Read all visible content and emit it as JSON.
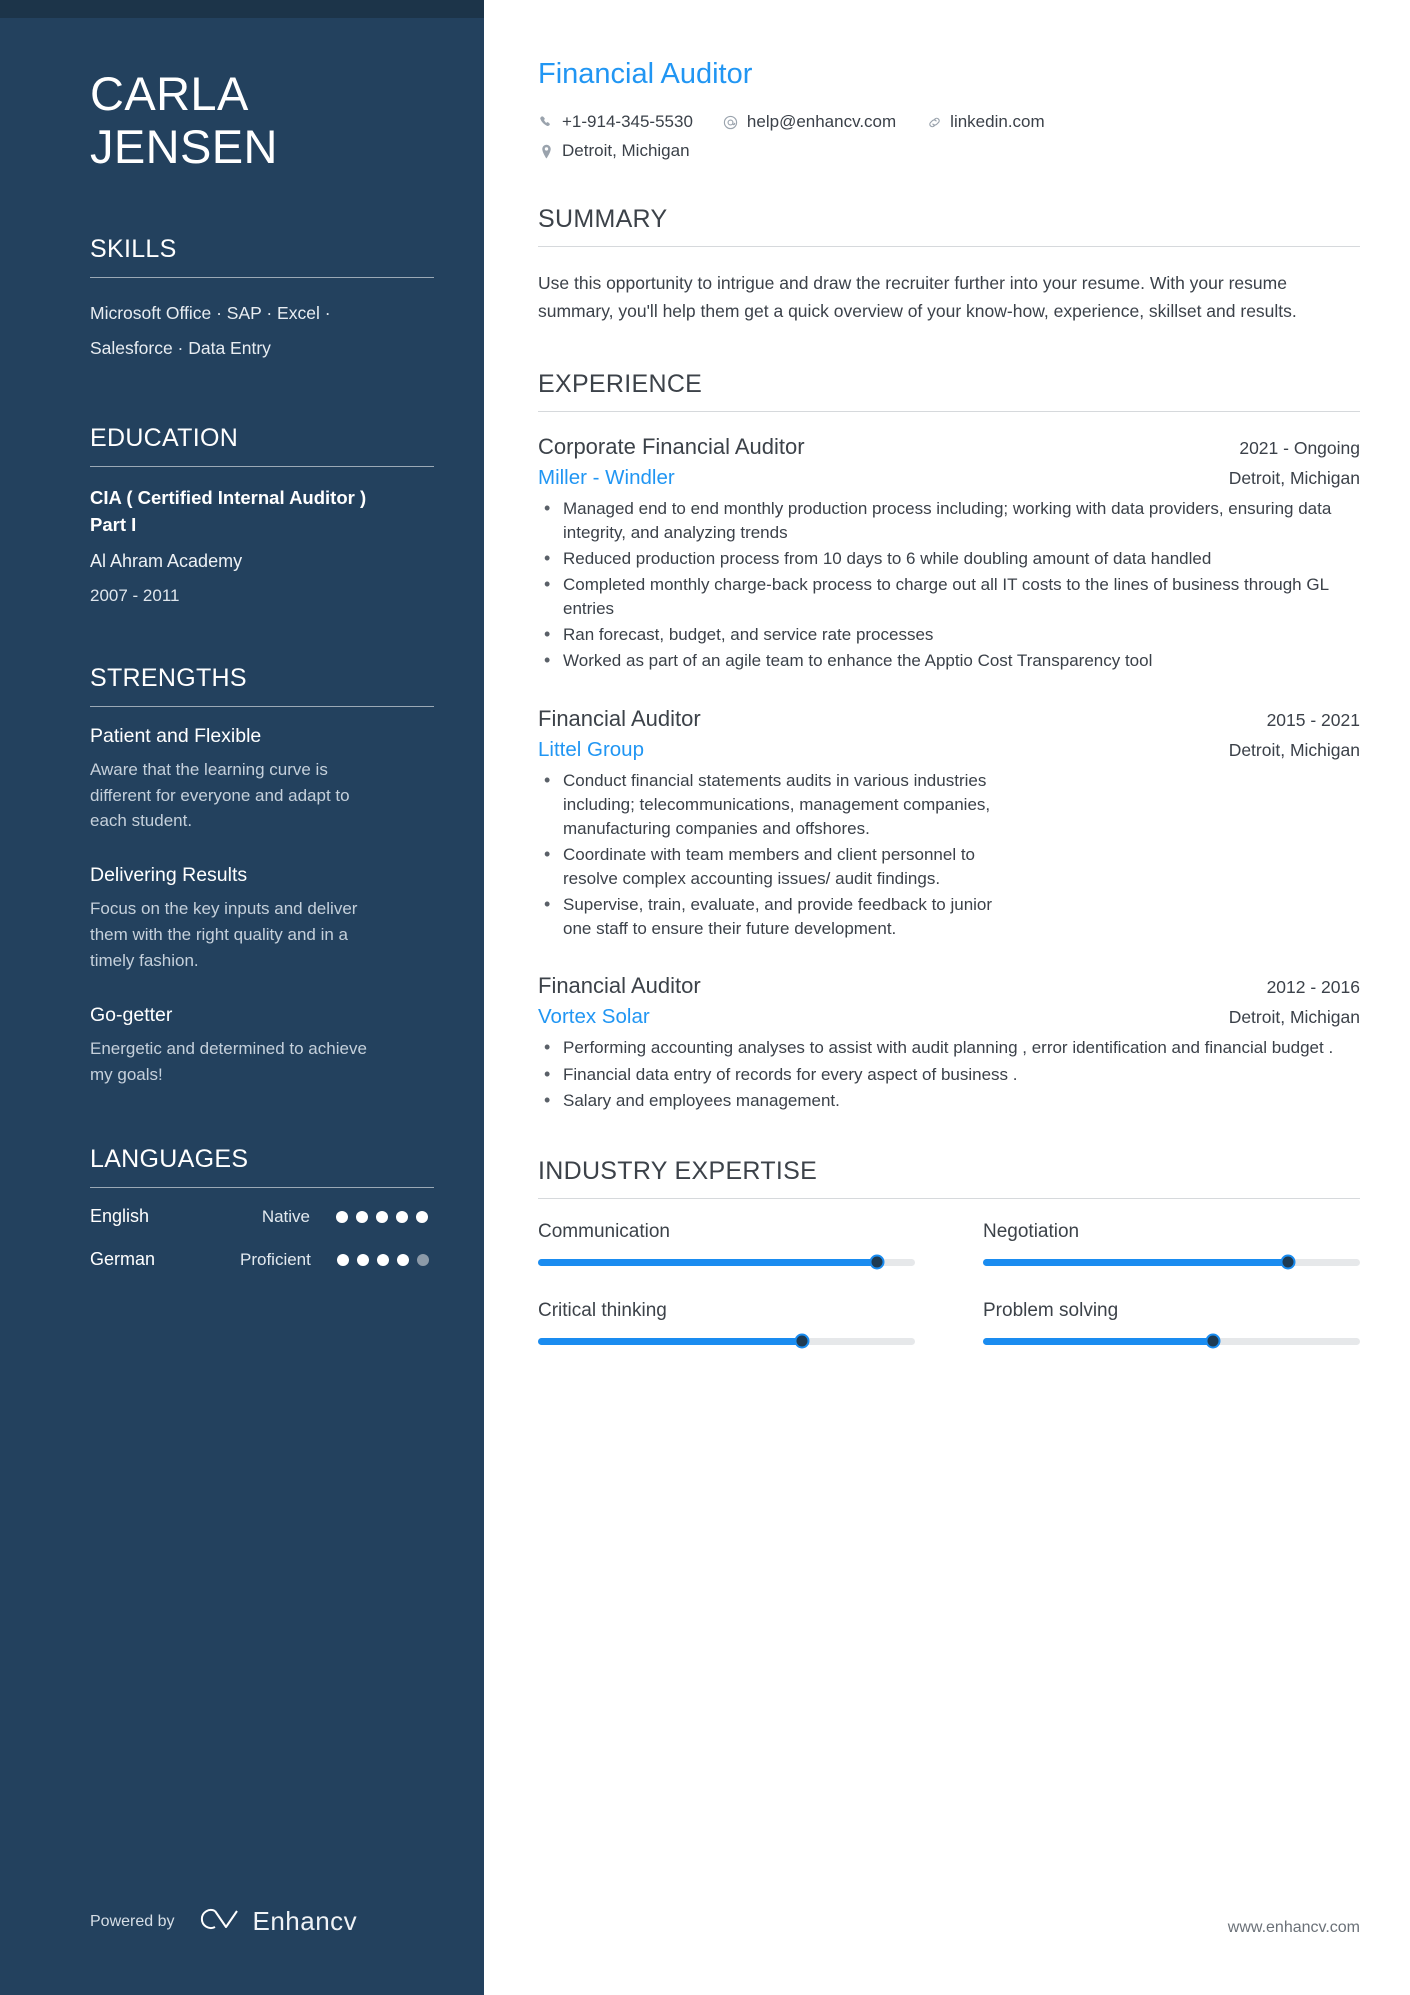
{
  "sidebar": {
    "name_line1": "CARLA",
    "name_line2": "JENSEN",
    "skills": {
      "heading": "SKILLS",
      "line1": "Microsoft Office · SAP · Excel ·",
      "line2": "Salesforce · Data Entry"
    },
    "education": {
      "heading": "EDUCATION",
      "degree": "CIA ( Certified Internal Auditor ) Part I",
      "school": "Al Ahram Academy",
      "dates": "2007 - 2011"
    },
    "strengths": {
      "heading": "STRENGTHS",
      "items": [
        {
          "title": "Patient and Flexible",
          "desc": "Aware that the learning curve is different for everyone and adapt to each student."
        },
        {
          "title": "Delivering Results",
          "desc": "Focus on the key inputs and deliver them with the right quality and in a timely fashion."
        },
        {
          "title": "Go-getter",
          "desc": "Energetic and determined to achieve my goals!"
        }
      ]
    },
    "languages": {
      "heading": "LANGUAGES",
      "items": [
        {
          "name": "English",
          "level": "Native",
          "filled": 5,
          "total": 5
        },
        {
          "name": "German",
          "level": "Proficient",
          "filled": 4,
          "total": 5
        }
      ]
    },
    "footer": {
      "powered_by": "Powered by",
      "brand": "Enhancv"
    }
  },
  "main": {
    "job_title": "Financial Auditor",
    "contact": {
      "phone": "+1-914-345-5530",
      "email": "help@enhancv.com",
      "linkedin": "linkedin.com",
      "location": "Detroit, Michigan"
    },
    "summary": {
      "heading": "SUMMARY",
      "text": "Use this opportunity to intrigue and draw the recruiter further into your resume. With your resume summary, you'll help them get a quick overview of your know-how, experience, skillset and results."
    },
    "experience": {
      "heading": "EXPERIENCE",
      "jobs": [
        {
          "role": "Corporate Financial Auditor",
          "dates": "2021 - Ongoing",
          "company": "Miller - Windler",
          "location": "Detroit, Michigan",
          "narrow": false,
          "bullets": [
            "Managed end to end monthly production process including; working with data providers, ensuring data integrity, and analyzing trends",
            "Reduced production process from 10 days to 6 while doubling amount of data handled",
            "Completed monthly charge-back process to charge out all IT costs to the lines of business through GL entries",
            "Ran forecast, budget, and service rate processes",
            "Worked as part of an agile team to enhance the Apptio Cost Transparency tool"
          ]
        },
        {
          "role": "Financial Auditor",
          "dates": "2015 - 2021",
          "company": "Littel Group",
          "location": "Detroit, Michigan",
          "narrow": true,
          "bullets": [
            "Conduct financial statements audits in various industries including; telecommunications, management companies, manufacturing companies and offshores.",
            "Coordinate with team members and client personnel to resolve complex accounting issues/ audit findings.",
            "Supervise, train, evaluate, and provide feedback to junior one staff to ensure their future development."
          ]
        },
        {
          "role": "Financial Auditor",
          "dates": "2012 - 2016",
          "company": "Vortex Solar",
          "location": "Detroit, Michigan",
          "narrow": false,
          "bullets": [
            "Performing accounting analyses to assist with audit planning , error identification and financial budget .",
            "Financial data entry of records for every aspect of business .",
            "Salary and employees management."
          ]
        }
      ]
    },
    "expertise": {
      "heading": "INDUSTRY EXPERTISE",
      "items": [
        {
          "label": "Communication",
          "value": 90
        },
        {
          "label": "Negotiation",
          "value": 81
        },
        {
          "label": "Critical thinking",
          "value": 70
        },
        {
          "label": "Problem solving",
          "value": 61
        }
      ]
    },
    "footer_url": "www.enhancv.com"
  },
  "colors": {
    "sidebar_bg": "#23415e",
    "accent_blue": "#2196f3",
    "slider_blue": "#1a8cf0",
    "knob": "#1d3a52"
  }
}
